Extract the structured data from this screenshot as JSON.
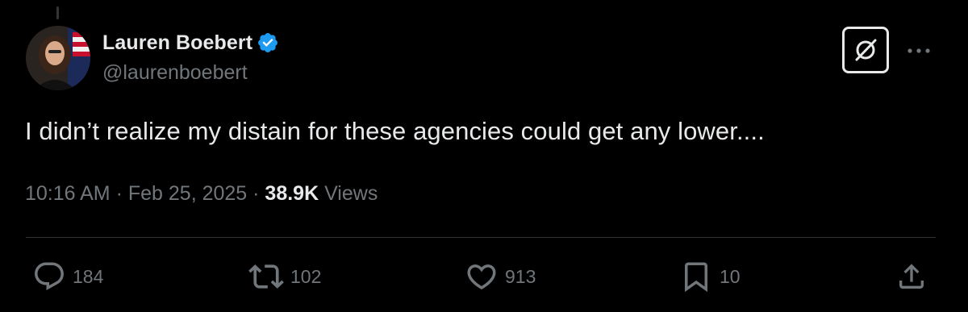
{
  "tweet": {
    "author": {
      "display_name": "Lauren Boebert",
      "handle": "@laurenboebert",
      "verified": true,
      "verified_icon": "verified-badge-icon"
    },
    "text": "I didn’t realize my distain for these agencies could get any lower....",
    "timestamp": {
      "time": "10:16 AM",
      "separator_1": " · ",
      "date": "Feb 25, 2025",
      "separator_2": " · ",
      "views_count": "38.9K",
      "views_label": " Views"
    },
    "actions": {
      "replies": "184",
      "reposts": "102",
      "likes": "913",
      "bookmarks": "10"
    }
  },
  "colors": {
    "background": "#000000",
    "primary_text": "#e7e9ea",
    "secondary_text": "#71767b",
    "verified_blue": "#1d9bf0",
    "divider": "#2f3336"
  }
}
